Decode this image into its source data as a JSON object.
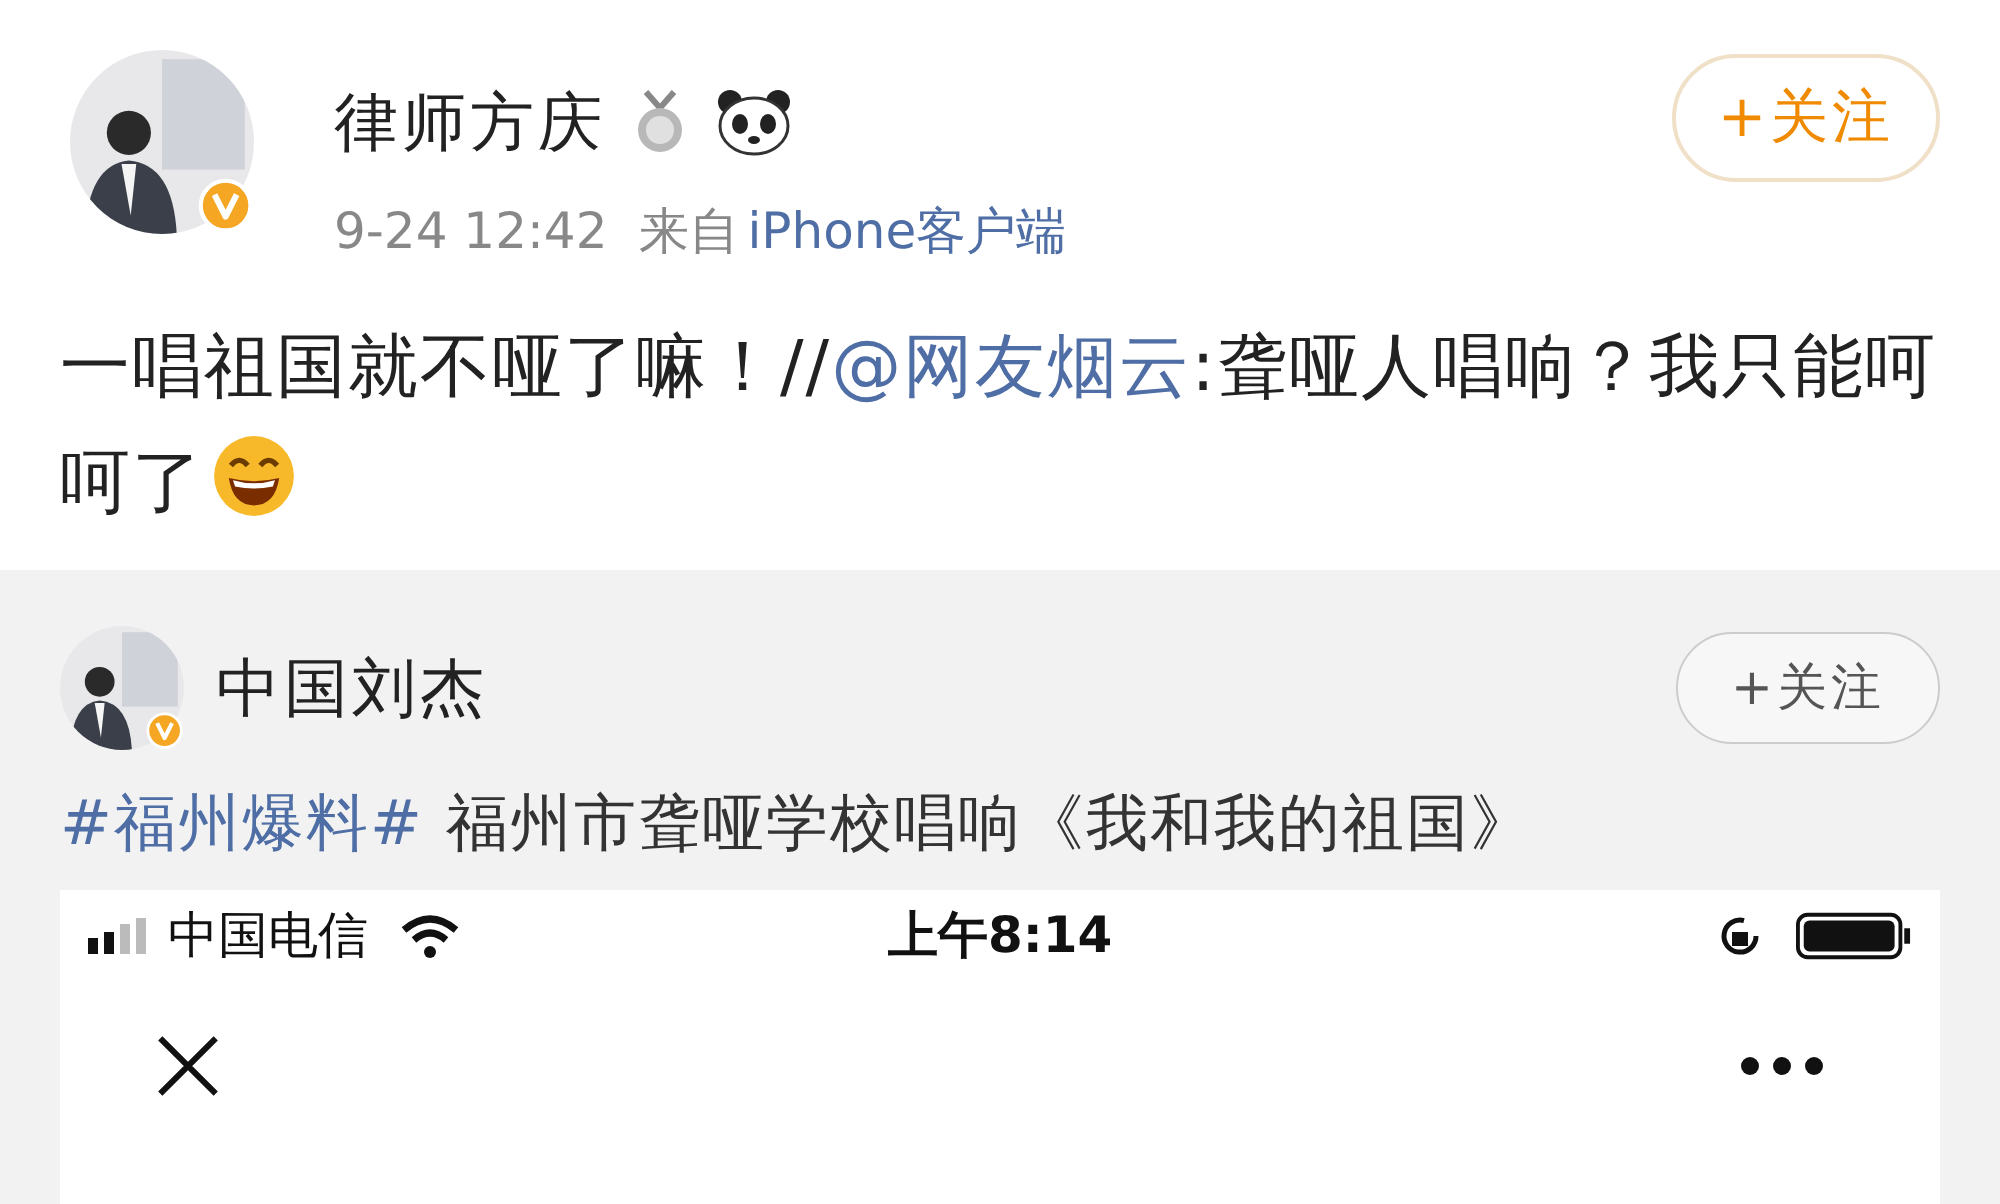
{
  "post": {
    "author": "律师方庆",
    "time": "9-24 12:42",
    "source_prefix": "来自",
    "source": "iPhone客户端",
    "follow": "+关注",
    "text_before": "一唱祖国就不哑了嘛！//",
    "mention": "@网友烟云",
    "text_after": ":聋哑人唱响？我只能呵呵了"
  },
  "repost": {
    "author": "中国刘杰",
    "follow": "+关注",
    "hashtag": "#福州爆料#",
    "text": "福州市聋哑学校唱响《我和我的祖国》",
    "phone": {
      "carrier": "中国电信",
      "time": "上午8:14"
    }
  }
}
